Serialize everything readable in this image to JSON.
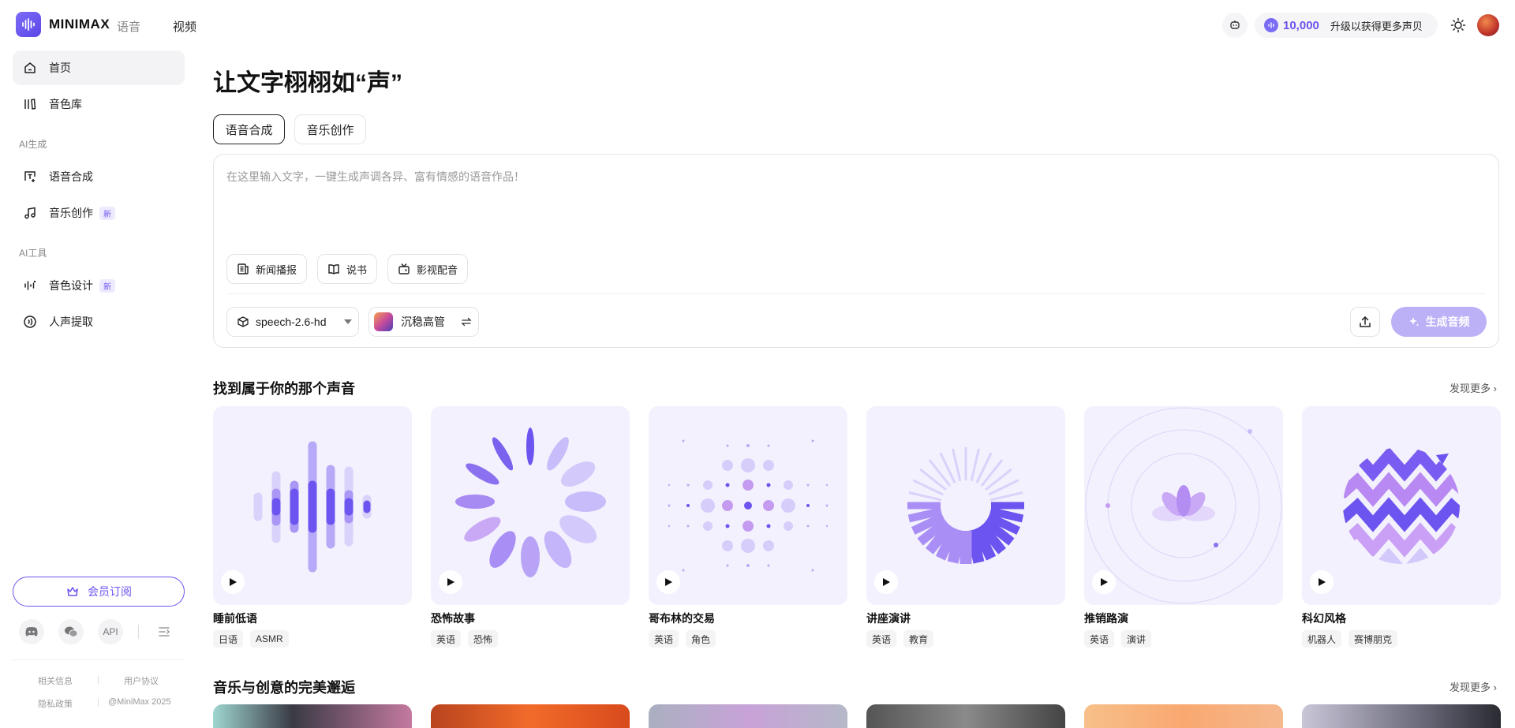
{
  "header": {
    "brand": "MINIMAX",
    "brand_sub": "语音",
    "nav_video": "视频",
    "credits": "10,000",
    "upgrade": "升级以获得更多声贝"
  },
  "sidebar": {
    "home": "首页",
    "voice_library": "音色库",
    "section_ai_gen": "AI生成",
    "tts": "语音合成",
    "music": "音乐创作",
    "music_badge": "新",
    "section_ai_tools": "AI工具",
    "voice_design": "音色设计",
    "voice_design_badge": "新",
    "vocal_extract": "人声提取",
    "member": "会员订阅",
    "api": "API",
    "footer": {
      "related": "相关信息",
      "agreement": "用户协议",
      "privacy": "隐私政策",
      "copyright": "@MiniMax 2025"
    }
  },
  "main": {
    "hero_title": "让文字栩栩如“声”",
    "tabs": [
      "语音合成",
      "音乐创作"
    ],
    "editor_placeholder": "在这里输入文字，一键生成声调各异、富有情感的语音作品！",
    "chips": [
      "新闻播报",
      "说书",
      "影视配音"
    ],
    "model": "speech-2.6-hd",
    "voice": "沉稳高管",
    "generate": "生成音频",
    "section1_title": "找到属于你的那个声音",
    "section2_title": "音乐与创意的完美邂逅",
    "more": "发现更多",
    "cards": [
      {
        "title": "睡前低语",
        "tags": [
          "日语",
          "ASMR"
        ]
      },
      {
        "title": "恐怖故事",
        "tags": [
          "英语",
          "恐怖"
        ]
      },
      {
        "title": "哥布林的交易",
        "tags": [
          "英语",
          "角色"
        ]
      },
      {
        "title": "讲座演讲",
        "tags": [
          "英语",
          "教育"
        ]
      },
      {
        "title": "推销路演",
        "tags": [
          "英语",
          "演讲"
        ]
      },
      {
        "title": "科幻风格",
        "tags": [
          "机器人",
          "赛博朋克"
        ]
      }
    ]
  },
  "colors": {
    "accent": "#6b54ef",
    "accent_light": "#bcb0f7",
    "card_bg": "#f3f1fd"
  }
}
